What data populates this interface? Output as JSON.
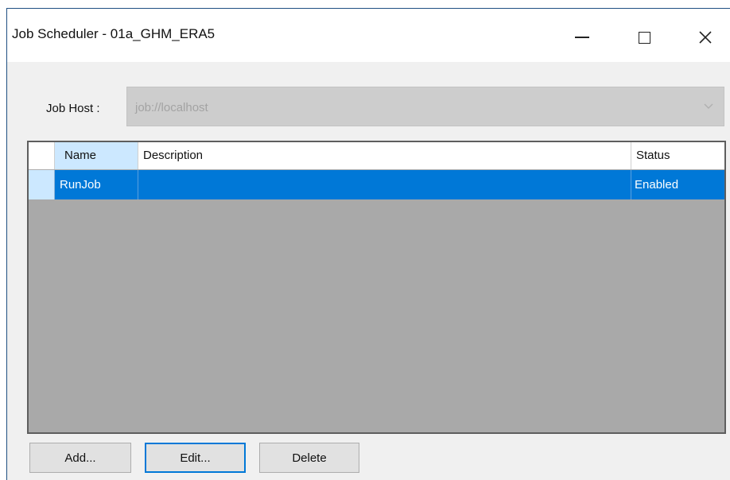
{
  "window": {
    "title": "Job Scheduler - 01a_GHM_ERA5",
    "controls": {
      "minimize": "minimize-icon",
      "maximize": "maximize-icon",
      "close": "close-icon"
    }
  },
  "job_host": {
    "label": "Job Host :",
    "value": "job://localhost",
    "enabled": false
  },
  "grid": {
    "columns": [
      "Name",
      "Description",
      "Status"
    ],
    "rows": [
      {
        "name": "RunJob",
        "description": "",
        "status": "Enabled",
        "selected": true
      }
    ]
  },
  "buttons": {
    "add": "Add...",
    "edit": "Edit...",
    "delete": "Delete"
  },
  "colors": {
    "selection": "#0078d7",
    "grid_background": "#a9a9a9",
    "focus_border": "#0078d7"
  }
}
